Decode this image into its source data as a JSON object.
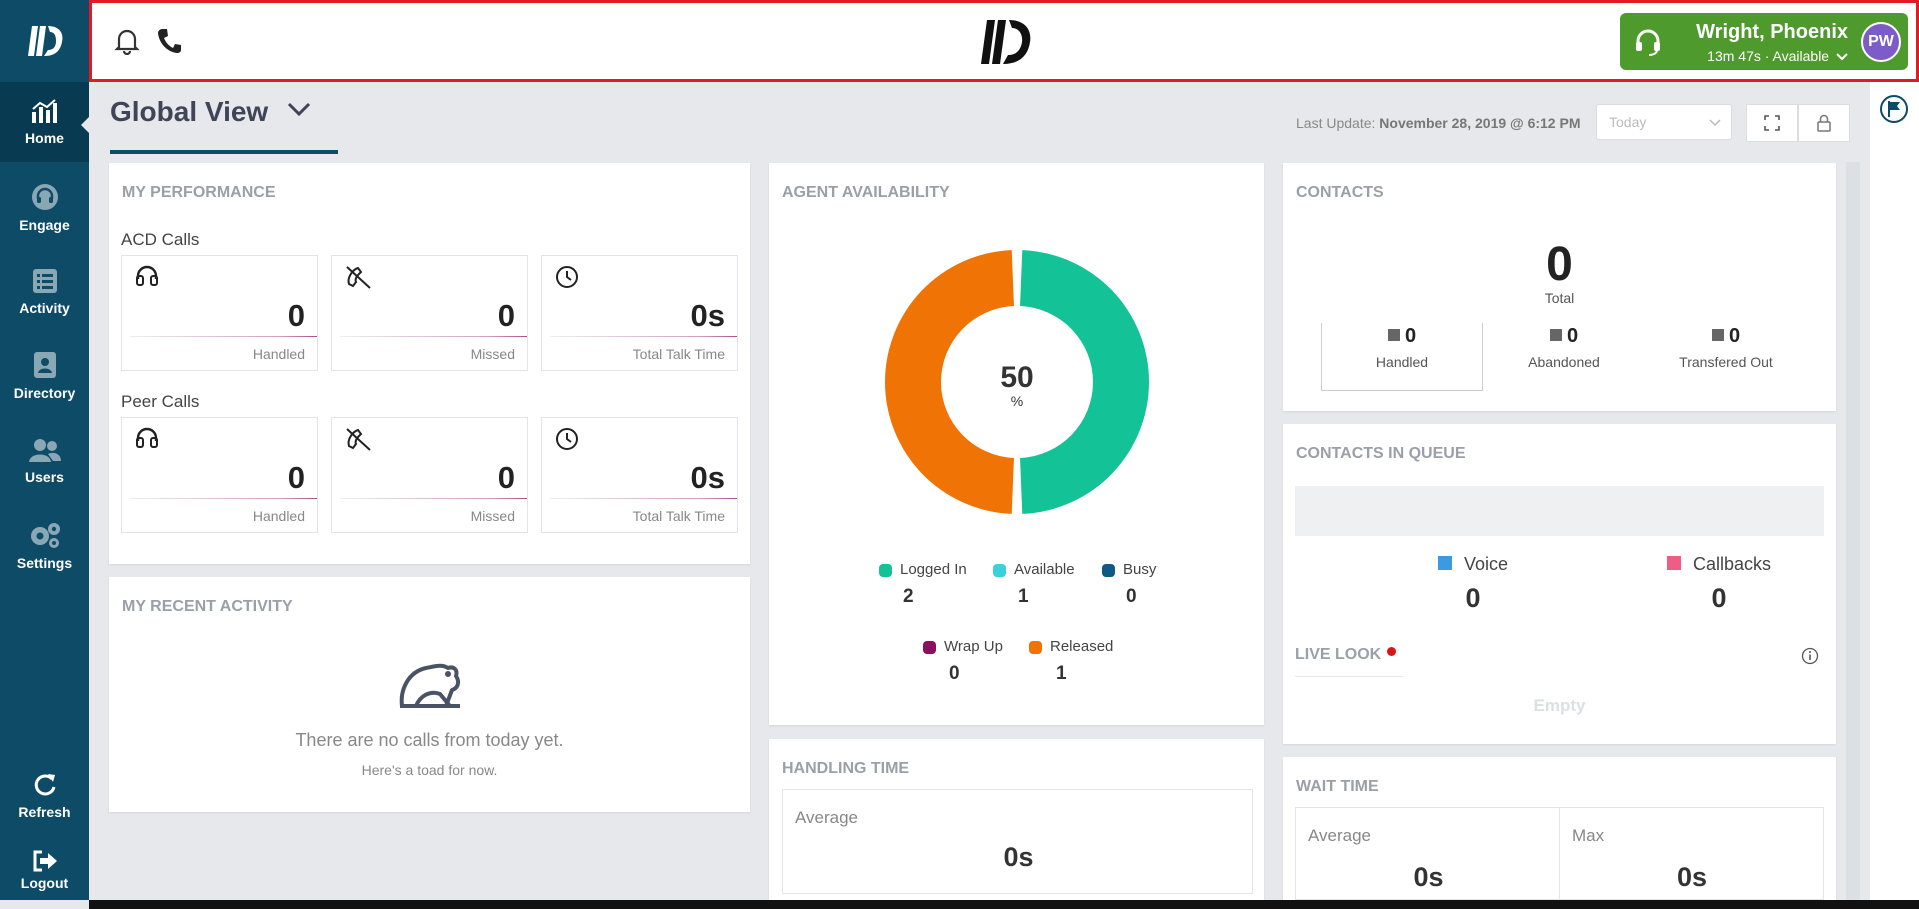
{
  "sidebar": {
    "items": [
      {
        "label": "Home",
        "icon": "bar-chart-icon"
      },
      {
        "label": "Engage",
        "icon": "headset-icon"
      },
      {
        "label": "Activity",
        "icon": "list-icon"
      },
      {
        "label": "Directory",
        "icon": "contact-book-icon"
      },
      {
        "label": "Users",
        "icon": "users-icon"
      },
      {
        "label": "Settings",
        "icon": "gears-icon"
      }
    ],
    "refresh_label": "Refresh",
    "logout_label": "Logout"
  },
  "header": {
    "user_name": "Wright, Phoenix",
    "user_status": "13m 47s · Available",
    "avatar_initials": "PW",
    "status_color": "#4f9a2d"
  },
  "page": {
    "title": "Global View",
    "last_update_prefix": "Last Update:",
    "last_update_value": "November 28, 2019 @ 6:12 PM",
    "range_select": "Today"
  },
  "performance": {
    "title": "MY PERFORMANCE",
    "acd_label": "ACD Calls",
    "peer_label": "Peer Calls",
    "acd": [
      {
        "value": "0",
        "label": "Handled"
      },
      {
        "value": "0",
        "label": "Missed"
      },
      {
        "value": "0s",
        "label": "Total Talk Time"
      }
    ],
    "peer": [
      {
        "value": "0",
        "label": "Handled"
      },
      {
        "value": "0",
        "label": "Missed"
      },
      {
        "value": "0s",
        "label": "Total Talk Time"
      }
    ]
  },
  "recent": {
    "title": "MY RECENT ACTIVITY",
    "empty_text": "There are no calls from today yet.",
    "empty_sub": "Here's a toad for now."
  },
  "availability": {
    "title": "AGENT AVAILABILITY",
    "center_value": "50",
    "center_unit": "%",
    "available_fraction": 0.5,
    "colors": {
      "logged_in": "#13c296",
      "available": "#3dd0d8",
      "busy": "#0e5a85",
      "wrap_up": "#8a1060",
      "released": "#f07306"
    },
    "legend": [
      {
        "label": "Logged In",
        "value": "2"
      },
      {
        "label": "Available",
        "value": "1"
      },
      {
        "label": "Busy",
        "value": "0"
      },
      {
        "label": "Wrap Up",
        "value": "0"
      },
      {
        "label": "Released",
        "value": "1"
      }
    ]
  },
  "handling": {
    "title": "HANDLING TIME",
    "avg_label": "Average",
    "avg_value": "0s"
  },
  "contacts": {
    "title": "CONTACTS",
    "total_value": "0",
    "total_label": "Total",
    "items": [
      {
        "value": "0",
        "label": "Handled"
      },
      {
        "value": "0",
        "label": "Abandoned"
      },
      {
        "value": "0",
        "label": "Transfered Out"
      }
    ]
  },
  "queue": {
    "title": "CONTACTS IN QUEUE",
    "voice_label": "Voice",
    "voice_value": "0",
    "voice_color": "#3a9be0",
    "callbacks_label": "Callbacks",
    "callbacks_value": "0",
    "callbacks_color": "#ef5d85",
    "live_look_label": "LIVE LOOK",
    "empty_label": "Empty"
  },
  "wait": {
    "title": "WAIT TIME",
    "avg_label": "Average",
    "avg_value": "0s",
    "max_label": "Max",
    "max_value": "0s"
  }
}
